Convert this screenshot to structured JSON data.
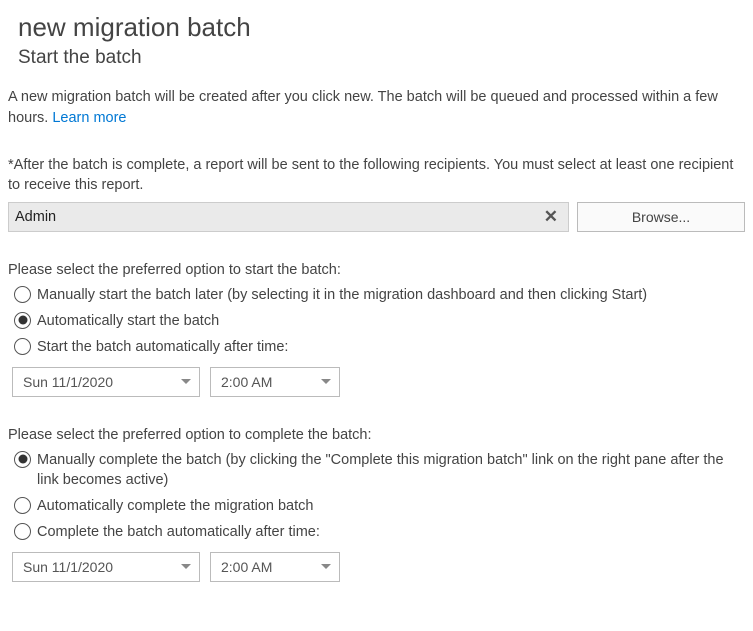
{
  "title": "new migration batch",
  "subtitle": "Start the batch",
  "intro_text": "A new migration batch will be created after you click new. The batch will be queued and processed within a few hours. ",
  "learn_more": "Learn more",
  "report_note": "*After the batch is complete, a report will be sent to the following recipients. You must select at least one recipient to receive this report.",
  "recipient": {
    "name": "Admin",
    "browse_label": "Browse..."
  },
  "start": {
    "prompt": "Please select the preferred option to start the batch:",
    "options": {
      "manual": "Manually start the batch later (by selecting it in the migration dashboard and then clicking Start)",
      "auto": "Automatically start the batch",
      "after": "Start the batch automatically after time:"
    },
    "selected": "auto",
    "date": "Sun 11/1/2020",
    "time": "2:00 AM"
  },
  "complete": {
    "prompt": "Please select the preferred option to complete the batch:",
    "options": {
      "manual": "Manually complete the batch (by clicking the \"Complete this migration batch\" link on the right pane after the link becomes active)",
      "auto": "Automatically complete the migration batch",
      "after": "Complete the batch automatically after time:"
    },
    "selected": "manual",
    "date": "Sun 11/1/2020",
    "time": "2:00 AM"
  }
}
